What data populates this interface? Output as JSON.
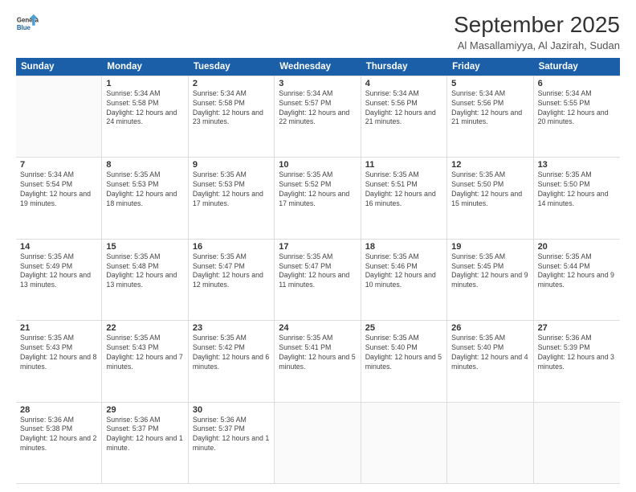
{
  "logo": {
    "line1": "General",
    "line2": "Blue"
  },
  "title": "September 2025",
  "subtitle": "Al Masallamiyya, Al Jazirah, Sudan",
  "header_days": [
    "Sunday",
    "Monday",
    "Tuesday",
    "Wednesday",
    "Thursday",
    "Friday",
    "Saturday"
  ],
  "weeks": [
    [
      {
        "day": "",
        "sunrise": "",
        "sunset": "",
        "daylight": ""
      },
      {
        "day": "1",
        "sunrise": "Sunrise: 5:34 AM",
        "sunset": "Sunset: 5:58 PM",
        "daylight": "Daylight: 12 hours and 24 minutes."
      },
      {
        "day": "2",
        "sunrise": "Sunrise: 5:34 AM",
        "sunset": "Sunset: 5:58 PM",
        "daylight": "Daylight: 12 hours and 23 minutes."
      },
      {
        "day": "3",
        "sunrise": "Sunrise: 5:34 AM",
        "sunset": "Sunset: 5:57 PM",
        "daylight": "Daylight: 12 hours and 22 minutes."
      },
      {
        "day": "4",
        "sunrise": "Sunrise: 5:34 AM",
        "sunset": "Sunset: 5:56 PM",
        "daylight": "Daylight: 12 hours and 21 minutes."
      },
      {
        "day": "5",
        "sunrise": "Sunrise: 5:34 AM",
        "sunset": "Sunset: 5:56 PM",
        "daylight": "Daylight: 12 hours and 21 minutes."
      },
      {
        "day": "6",
        "sunrise": "Sunrise: 5:34 AM",
        "sunset": "Sunset: 5:55 PM",
        "daylight": "Daylight: 12 hours and 20 minutes."
      }
    ],
    [
      {
        "day": "7",
        "sunrise": "Sunrise: 5:34 AM",
        "sunset": "Sunset: 5:54 PM",
        "daylight": "Daylight: 12 hours and 19 minutes."
      },
      {
        "day": "8",
        "sunrise": "Sunrise: 5:35 AM",
        "sunset": "Sunset: 5:53 PM",
        "daylight": "Daylight: 12 hours and 18 minutes."
      },
      {
        "day": "9",
        "sunrise": "Sunrise: 5:35 AM",
        "sunset": "Sunset: 5:53 PM",
        "daylight": "Daylight: 12 hours and 17 minutes."
      },
      {
        "day": "10",
        "sunrise": "Sunrise: 5:35 AM",
        "sunset": "Sunset: 5:52 PM",
        "daylight": "Daylight: 12 hours and 17 minutes."
      },
      {
        "day": "11",
        "sunrise": "Sunrise: 5:35 AM",
        "sunset": "Sunset: 5:51 PM",
        "daylight": "Daylight: 12 hours and 16 minutes."
      },
      {
        "day": "12",
        "sunrise": "Sunrise: 5:35 AM",
        "sunset": "Sunset: 5:50 PM",
        "daylight": "Daylight: 12 hours and 15 minutes."
      },
      {
        "day": "13",
        "sunrise": "Sunrise: 5:35 AM",
        "sunset": "Sunset: 5:50 PM",
        "daylight": "Daylight: 12 hours and 14 minutes."
      }
    ],
    [
      {
        "day": "14",
        "sunrise": "Sunrise: 5:35 AM",
        "sunset": "Sunset: 5:49 PM",
        "daylight": "Daylight: 12 hours and 13 minutes."
      },
      {
        "day": "15",
        "sunrise": "Sunrise: 5:35 AM",
        "sunset": "Sunset: 5:48 PM",
        "daylight": "Daylight: 12 hours and 13 minutes."
      },
      {
        "day": "16",
        "sunrise": "Sunrise: 5:35 AM",
        "sunset": "Sunset: 5:47 PM",
        "daylight": "Daylight: 12 hours and 12 minutes."
      },
      {
        "day": "17",
        "sunrise": "Sunrise: 5:35 AM",
        "sunset": "Sunset: 5:47 PM",
        "daylight": "Daylight: 12 hours and 11 minutes."
      },
      {
        "day": "18",
        "sunrise": "Sunrise: 5:35 AM",
        "sunset": "Sunset: 5:46 PM",
        "daylight": "Daylight: 12 hours and 10 minutes."
      },
      {
        "day": "19",
        "sunrise": "Sunrise: 5:35 AM",
        "sunset": "Sunset: 5:45 PM",
        "daylight": "Daylight: 12 hours and 9 minutes."
      },
      {
        "day": "20",
        "sunrise": "Sunrise: 5:35 AM",
        "sunset": "Sunset: 5:44 PM",
        "daylight": "Daylight: 12 hours and 9 minutes."
      }
    ],
    [
      {
        "day": "21",
        "sunrise": "Sunrise: 5:35 AM",
        "sunset": "Sunset: 5:43 PM",
        "daylight": "Daylight: 12 hours and 8 minutes."
      },
      {
        "day": "22",
        "sunrise": "Sunrise: 5:35 AM",
        "sunset": "Sunset: 5:43 PM",
        "daylight": "Daylight: 12 hours and 7 minutes."
      },
      {
        "day": "23",
        "sunrise": "Sunrise: 5:35 AM",
        "sunset": "Sunset: 5:42 PM",
        "daylight": "Daylight: 12 hours and 6 minutes."
      },
      {
        "day": "24",
        "sunrise": "Sunrise: 5:35 AM",
        "sunset": "Sunset: 5:41 PM",
        "daylight": "Daylight: 12 hours and 5 minutes."
      },
      {
        "day": "25",
        "sunrise": "Sunrise: 5:35 AM",
        "sunset": "Sunset: 5:40 PM",
        "daylight": "Daylight: 12 hours and 5 minutes."
      },
      {
        "day": "26",
        "sunrise": "Sunrise: 5:35 AM",
        "sunset": "Sunset: 5:40 PM",
        "daylight": "Daylight: 12 hours and 4 minutes."
      },
      {
        "day": "27",
        "sunrise": "Sunrise: 5:36 AM",
        "sunset": "Sunset: 5:39 PM",
        "daylight": "Daylight: 12 hours and 3 minutes."
      }
    ],
    [
      {
        "day": "28",
        "sunrise": "Sunrise: 5:36 AM",
        "sunset": "Sunset: 5:38 PM",
        "daylight": "Daylight: 12 hours and 2 minutes."
      },
      {
        "day": "29",
        "sunrise": "Sunrise: 5:36 AM",
        "sunset": "Sunset: 5:37 PM",
        "daylight": "Daylight: 12 hours and 1 minute."
      },
      {
        "day": "30",
        "sunrise": "Sunrise: 5:36 AM",
        "sunset": "Sunset: 5:37 PM",
        "daylight": "Daylight: 12 hours and 1 minute."
      },
      {
        "day": "",
        "sunrise": "",
        "sunset": "",
        "daylight": ""
      },
      {
        "day": "",
        "sunrise": "",
        "sunset": "",
        "daylight": ""
      },
      {
        "day": "",
        "sunrise": "",
        "sunset": "",
        "daylight": ""
      },
      {
        "day": "",
        "sunrise": "",
        "sunset": "",
        "daylight": ""
      }
    ]
  ]
}
